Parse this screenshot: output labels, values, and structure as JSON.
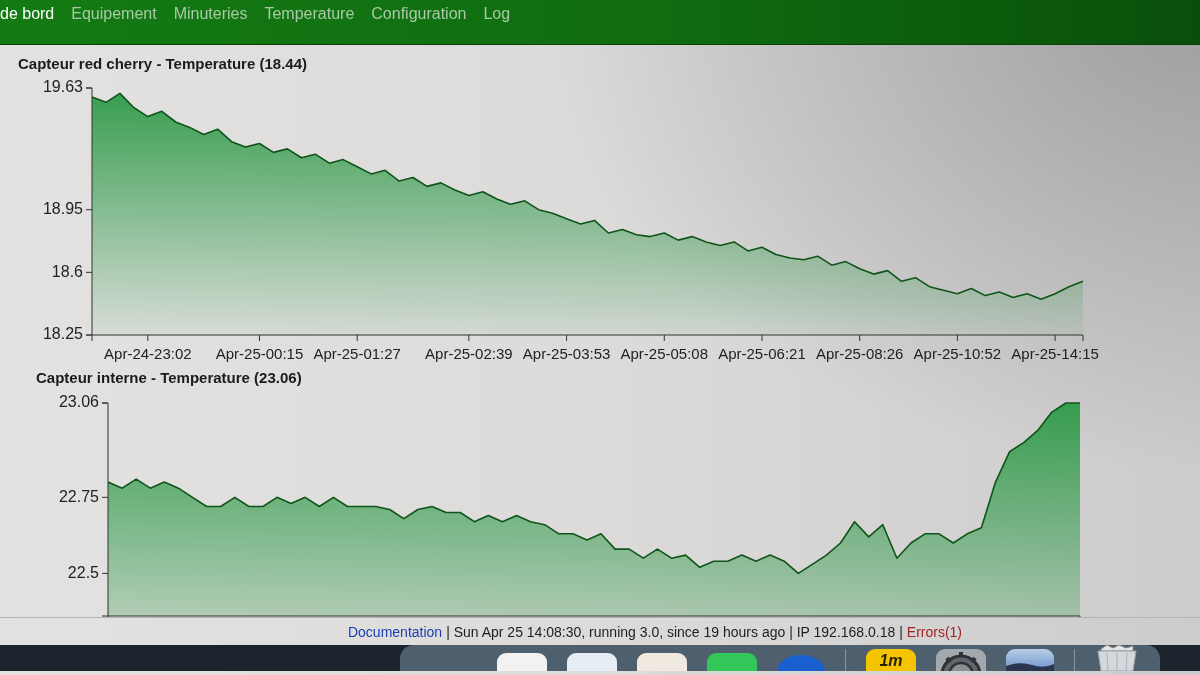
{
  "nav": {
    "items": [
      {
        "label": "de bord",
        "selected": true
      },
      {
        "label": "Equipement",
        "selected": false
      },
      {
        "label": "Minuteries",
        "selected": false
      },
      {
        "label": "Temperature",
        "selected": false
      },
      {
        "label": "Configuration",
        "selected": false
      },
      {
        "label": "Log",
        "selected": false
      }
    ]
  },
  "charts": [
    {
      "chart_data": {
        "type": "area",
        "title": "Capteur red cherry - Temperature (18.44)",
        "ylim": [
          18.25,
          19.63
        ],
        "yticks": [
          18.25,
          18.6,
          18.95,
          19.63
        ],
        "categories": [
          null,
          null,
          null,
          null,
          "Apr-24-23:02",
          null,
          null,
          null,
          null,
          null,
          null,
          null,
          "Apr-25-00:15",
          null,
          null,
          null,
          null,
          null,
          null,
          "Apr-25-01:27",
          null,
          null,
          null,
          null,
          null,
          null,
          null,
          "Apr-25-02:39",
          null,
          null,
          null,
          null,
          null,
          null,
          "Apr-25-03:53",
          null,
          null,
          null,
          null,
          null,
          null,
          "Apr-25-05:08",
          null,
          null,
          null,
          null,
          null,
          null,
          "Apr-25-06:21",
          null,
          null,
          null,
          null,
          null,
          null,
          "Apr-25-08:26",
          null,
          null,
          null,
          null,
          null,
          null,
          "Apr-25-10:52",
          null,
          null,
          null,
          null,
          null,
          null,
          "Apr-25-14:15",
          null,
          null
        ],
        "values": [
          19.58,
          19.55,
          19.6,
          19.52,
          19.47,
          19.5,
          19.44,
          19.41,
          19.37,
          19.4,
          19.33,
          19.3,
          19.32,
          19.27,
          19.29,
          19.24,
          19.26,
          19.21,
          19.23,
          19.19,
          19.15,
          19.17,
          19.11,
          19.13,
          19.08,
          19.1,
          19.06,
          19.03,
          19.05,
          19.01,
          18.98,
          19.0,
          18.95,
          18.93,
          18.9,
          18.87,
          18.89,
          18.82,
          18.84,
          18.81,
          18.8,
          18.82,
          18.78,
          18.8,
          18.77,
          18.75,
          18.77,
          18.72,
          18.74,
          18.7,
          18.68,
          18.67,
          18.69,
          18.64,
          18.66,
          18.62,
          18.59,
          18.61,
          18.55,
          18.57,
          18.52,
          18.5,
          18.48,
          18.51,
          18.47,
          18.49,
          18.46,
          18.48,
          18.45,
          18.48,
          18.52,
          18.55
        ]
      }
    },
    {
      "chart_data": {
        "type": "area",
        "title": "Capteur interne - Temperature (23.06)",
        "ylim": [
          22.36,
          23.06
        ],
        "yticks": [
          22.5,
          22.75,
          23.06
        ],
        "categories": [
          null,
          null,
          null,
          null,
          null,
          null,
          null,
          null,
          null,
          null,
          null,
          null,
          null,
          null,
          null,
          null,
          null,
          null,
          null,
          null,
          null,
          null,
          null,
          null,
          null,
          null,
          null,
          null,
          null,
          null,
          null,
          null,
          null,
          null,
          null,
          null,
          null,
          null,
          null,
          null,
          null,
          null,
          null,
          null,
          null,
          null,
          null,
          null,
          null,
          null,
          null,
          null,
          null,
          null,
          null,
          null,
          null,
          null,
          null,
          null,
          null,
          null,
          null,
          null,
          null,
          null,
          null,
          null,
          null,
          null
        ],
        "values": [
          22.8,
          22.78,
          22.81,
          22.78,
          22.8,
          22.78,
          22.75,
          22.72,
          22.72,
          22.75,
          22.72,
          22.72,
          22.75,
          22.73,
          22.75,
          22.72,
          22.75,
          22.72,
          22.72,
          22.72,
          22.71,
          22.68,
          22.71,
          22.72,
          22.7,
          22.7,
          22.67,
          22.69,
          22.67,
          22.69,
          22.67,
          22.66,
          22.63,
          22.63,
          22.61,
          22.63,
          22.58,
          22.58,
          22.55,
          22.58,
          22.55,
          22.56,
          22.52,
          22.54,
          22.54,
          22.56,
          22.54,
          22.56,
          22.54,
          22.5,
          22.53,
          22.56,
          22.6,
          22.67,
          22.62,
          22.66,
          22.55,
          22.6,
          22.63,
          22.63,
          22.6,
          22.63,
          22.65,
          22.8,
          22.9,
          22.93,
          22.97,
          23.03,
          23.06,
          23.06
        ]
      }
    }
  ],
  "footer": {
    "items": [
      {
        "kind": "link",
        "text": "Documentation"
      },
      {
        "kind": "text",
        "text": "| Sun Apr 25 14:08:30, running 3.0, since 19 hours ago | IP 192.168.0.18 |"
      },
      {
        "kind": "error_link",
        "text": "Errors(1)"
      }
    ]
  },
  "dock": {
    "items": [
      {
        "kind": "tile",
        "color": "#f2f2f2"
      },
      {
        "kind": "tile",
        "color": "#e6edf5"
      },
      {
        "kind": "tile",
        "color": "#f0e9df"
      },
      {
        "kind": "tile",
        "color": "#34c759"
      },
      {
        "kind": "round",
        "color": "#1a5fd0"
      },
      {
        "kind": "separator"
      },
      {
        "kind": "label",
        "color": "#f5c400",
        "label": "1m"
      },
      {
        "kind": "gear"
      },
      {
        "kind": "photo"
      },
      {
        "kind": "separator"
      },
      {
        "kind": "trash"
      }
    ]
  }
}
